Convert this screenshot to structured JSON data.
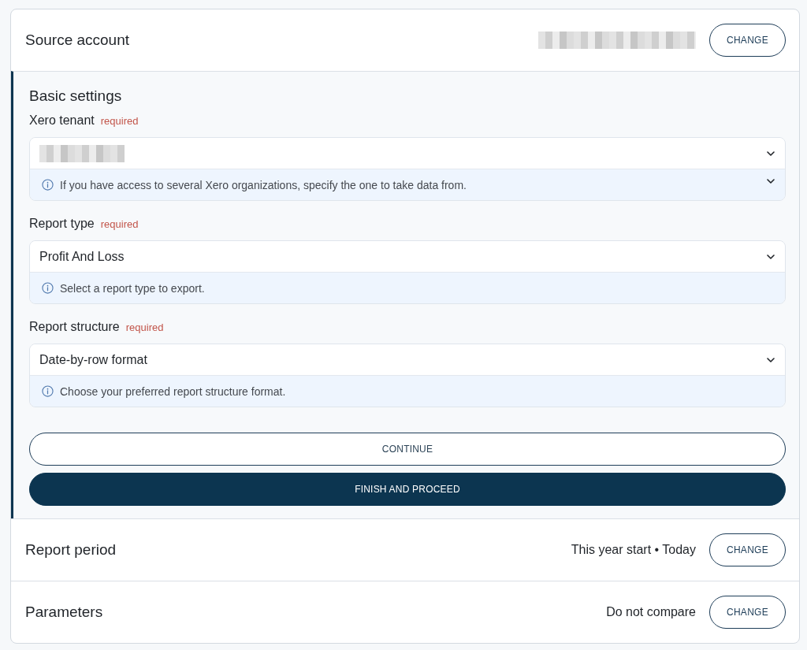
{
  "source_account": {
    "title": "Source account",
    "value_blurred": true,
    "button": "CHANGE"
  },
  "basic_settings": {
    "title": "Basic settings",
    "fields": [
      {
        "label": "Xero tenant",
        "required_tag": "required",
        "value_blurred": true,
        "hint": "If you have access to several Xero organizations, specify the one to take data from.",
        "hint_expandable": true
      },
      {
        "label": "Report type",
        "required_tag": "required",
        "value": "Profit And Loss",
        "value_blurred": false,
        "hint": "Select a report type to export.",
        "hint_expandable": false
      },
      {
        "label": "Report structure",
        "required_tag": "required",
        "value": "Date-by-row format",
        "value_blurred": false,
        "hint": "Choose your preferred report structure format.",
        "hint_expandable": false
      }
    ],
    "buttons": [
      {
        "label": "CONTINUE",
        "kind": "outline"
      },
      {
        "label": "FINISH AND PROCEED",
        "kind": "primary"
      }
    ]
  },
  "summary_rows": [
    {
      "title": "Report period",
      "value": "This year start • Today",
      "button": "CHANGE"
    },
    {
      "title": "Parameters",
      "value": "Do not compare",
      "button": "CHANGE"
    }
  ]
}
